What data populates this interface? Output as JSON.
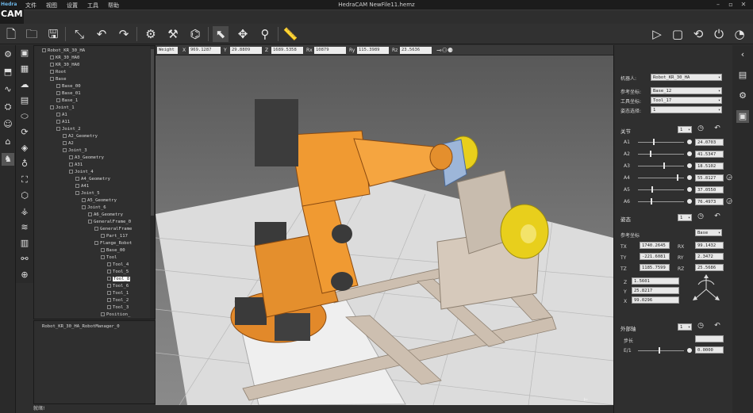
{
  "app": {
    "title": "HedraCAM  NewFile11.hemz",
    "logo_top": "Hedra",
    "logo_main": "CAM",
    "menu": [
      "文件",
      "视图",
      "设置",
      "工具",
      "帮助"
    ],
    "status": "就绪!"
  },
  "tree": {
    "rows": [
      "Robot_KR_30_HA",
      "KR_30_HA0",
      "KR_30_HA0",
      "Root",
      "Base",
      "Base_00",
      "Base_01",
      "Base_1",
      "Joint_1",
      "A1",
      "A11",
      "Joint_2",
      "A2_Geometry",
      "A2",
      "Joint_3",
      "A3_Geometry",
      "A31",
      "Joint_4",
      "A4_Geometry",
      "A41",
      "Joint_5",
      "A5_Geometry",
      "Joint_6",
      "A6_Geometry",
      "GeneralFrame_0",
      "GeneralFrame",
      "Part_117",
      "Flange_Robot",
      "Base_00",
      "Tool",
      "Tool_4",
      "Tool_5",
      "Tool_8",
      "Tool_6",
      "Tool_1",
      "Tool_2",
      "Tool_3",
      "Position_"
    ],
    "selected_row": "Tool_8",
    "bottom_item": "Robot_KR_30_HA_RobotManager_0"
  },
  "viewport": {
    "mode_field": "Weight",
    "fields": [
      {
        "label": "X",
        "value": "969.1287"
      },
      {
        "label": "Y",
        "value": "29.8809"
      },
      {
        "label": "Z",
        "value": "1689.5358"
      },
      {
        "label": "Rx",
        "value": "10879"
      },
      {
        "label": "Ry",
        "value": "115.3989"
      },
      {
        "label": "Rz",
        "value": "23.5636"
      }
    ]
  },
  "panel": {
    "robot_name_label": "机器人:",
    "robot_name": "Robot_KR_30_HA",
    "ref_coord_label": "参考坐标:",
    "ref_coord": "Base_12",
    "tool_coord_label": "工具坐标:",
    "tool_coord": "Tool_17",
    "pose_label": "姿态选择:",
    "pose": "1",
    "joints_header": "关节",
    "joints_index": "1",
    "joints": [
      {
        "name": "A1",
        "value": "24.0703",
        "pos": 0.32
      },
      {
        "name": "A2",
        "value": "41.5347",
        "pos": 0.25
      },
      {
        "name": "A3",
        "value": "18.5102",
        "pos": 0.55
      },
      {
        "name": "A4",
        "value": "55.8127",
        "pos": 0.85
      },
      {
        "name": "A5",
        "value": "37.0550",
        "pos": 0.3
      },
      {
        "name": "A6",
        "value": "76.4973",
        "pos": 0.28
      }
    ],
    "pose_header": "姿态",
    "pose_index": "1",
    "ref_coord2_label": "参考坐标",
    "ref_coord2": "Base",
    "tx": "1740.2645",
    "ty": "-221.6081",
    "tz": "1185.7599",
    "rx": "99.1432",
    "ry": "2.3472",
    "rz": "25.5686",
    "z_val": "1.5601",
    "y_val": "25.8217",
    "x_val": "99.0296",
    "ext_header": "外部轴",
    "ext_index": "1",
    "step_label": "步长",
    "step_value": "",
    "e1_label": "E/1",
    "e1_value": "0.0000"
  }
}
